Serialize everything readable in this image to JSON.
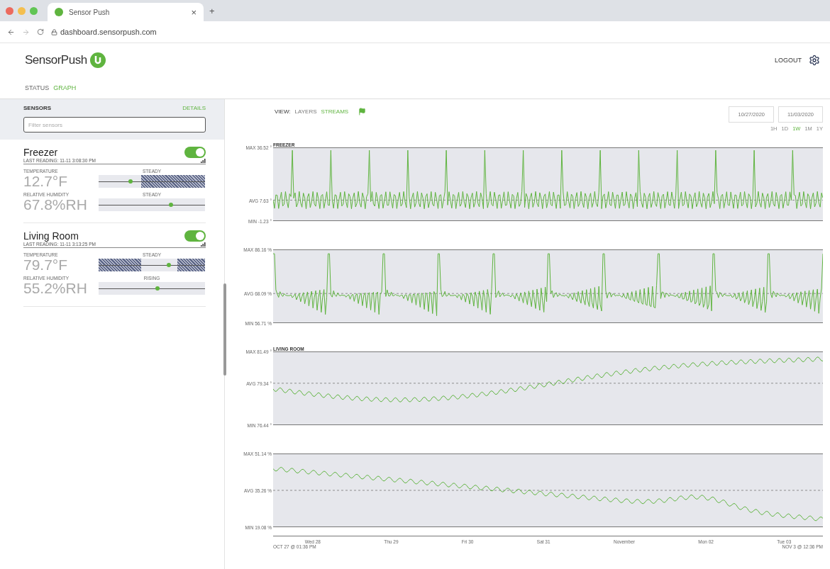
{
  "browser": {
    "tab_title": "Sensor Push",
    "tab_close": "×",
    "new_tab": "+",
    "url": "dashboard.sensorpush.com"
  },
  "header": {
    "logo": "SensorPush",
    "logout": "LOGOUT"
  },
  "nav": [
    {
      "label": "STATUS",
      "selected": false
    },
    {
      "label": "GRAPH",
      "selected": true
    }
  ],
  "sidebar": {
    "title": "SENSORS",
    "details": "DETAILS",
    "filter_placeholder": "Filter sensors",
    "sensors": [
      {
        "name": "Freezer",
        "on": true,
        "last_reading": "LAST READING: 11-11 3:08:30 PM",
        "metrics": [
          {
            "label": "TEMPERATURE",
            "trend": "STEADY",
            "value": "12.7°F",
            "level": 0.3,
            "kind": "high"
          },
          {
            "label": "RELATIVE HUMIDITY",
            "trend": "STEADY",
            "value": "67.8%RH",
            "level": 0.68,
            "kind": "plain"
          }
        ]
      },
      {
        "name": "Living Room",
        "on": true,
        "last_reading": "LAST READING: 11-11 3:13:25 PM",
        "metrics": [
          {
            "label": "TEMPERATURE",
            "trend": "STEADY",
            "value": "79.7°F",
            "level": 0.66,
            "kind": "outer"
          },
          {
            "label": "RELATIVE HUMIDITY",
            "trend": "RISING",
            "value": "55.2%RH",
            "level": 0.55,
            "kind": "plain"
          }
        ]
      }
    ]
  },
  "view": {
    "label": "VIEW:",
    "options": [
      {
        "label": "LAYERS",
        "selected": false
      },
      {
        "label": "STREAMS",
        "selected": true
      }
    ]
  },
  "dates": [
    "10/27/2020",
    "11/03/2020"
  ],
  "ranges": [
    {
      "label": "1H",
      "selected": false
    },
    {
      "label": "1D",
      "selected": false
    },
    {
      "label": "1W",
      "selected": true
    },
    {
      "label": "1M",
      "selected": false
    },
    {
      "label": "1Y",
      "selected": false
    }
  ],
  "charts": [
    {
      "title": "FREEZER",
      "kind": "spike",
      "max": "MAX 36.52 °",
      "avg": "AVG 7.63 °",
      "min": "MIN -1.23 °"
    },
    {
      "kind": "saw",
      "max": "MAX 86.16 %",
      "avg": "AVG 68.09 %",
      "min": "MIN 56.71 %"
    },
    {
      "title": "LIVING ROOM",
      "kind": "rise",
      "max": "MAX 81.49 °",
      "avg": "AVG 79.34 °",
      "min": "MIN 76.44 °"
    },
    {
      "kind": "fall",
      "max": "MAX 51.14 %",
      "avg": "AVG 35.26 %",
      "min": "MIN 19.08 %"
    }
  ],
  "x_axis": {
    "labels": [
      "Wed 28",
      "Thu 29",
      "Fri 30",
      "Sat 31",
      "November",
      "Mon 02",
      "Tue 03"
    ],
    "start": "OCT 27 @ 01:36 PM",
    "end": "NOV 3 @ 12:36 PM"
  }
}
